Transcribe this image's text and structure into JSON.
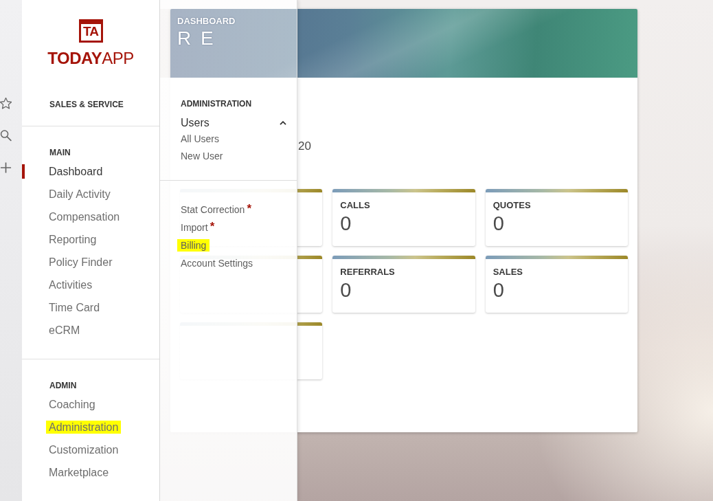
{
  "sidebar": {
    "logo": {
      "badge": "TA",
      "name": "**TODAY**APP"
    },
    "context": "SALES & SERVICE",
    "sections": [
      {
        "title": "MAIN",
        "items": [
          {
            "label": "Dashboard",
            "selected": true,
            "highlighted": false
          },
          {
            "label": "Daily Activity",
            "selected": false,
            "highlighted": false
          },
          {
            "label": "Compensation",
            "selected": false,
            "highlighted": false
          },
          {
            "label": "Reporting",
            "selected": false,
            "highlighted": false
          },
          {
            "label": "Policy Finder",
            "selected": false,
            "highlighted": false
          },
          {
            "label": "Activities",
            "selected": false,
            "highlighted": false
          },
          {
            "label": "Time Card",
            "selected": false,
            "highlighted": false
          },
          {
            "label": "eCRM",
            "selected": false,
            "highlighted": false
          }
        ]
      },
      {
        "title": "ADMIN",
        "items": [
          {
            "label": "Coaching",
            "selected": false,
            "highlighted": false
          },
          {
            "label": "Administration",
            "selected": false,
            "highlighted": true
          },
          {
            "label": "Customization",
            "selected": false,
            "highlighted": false
          },
          {
            "label": "Marketplace",
            "selected": false,
            "highlighted": false
          }
        ]
      }
    ]
  },
  "flyout": {
    "title": "ADMINISTRATION",
    "groups": [
      {
        "label": "Users",
        "expanded": true,
        "children": [
          {
            "label": "All Users",
            "highlighted": false
          },
          {
            "label": "New User",
            "highlighted": false
          }
        ]
      }
    ],
    "items": [
      {
        "label": "Stat Correction",
        "marker": "*",
        "highlighted": false
      },
      {
        "label": "Import",
        "marker": "*",
        "highlighted": false
      },
      {
        "label": "Billing",
        "highlighted": true
      },
      {
        "label": "Account Settings",
        "highlighted": false
      }
    ]
  },
  "dashboard": {
    "eyebrow": "DASHBOARD",
    "title": "R E",
    "date_fragment": "20",
    "cards": [
      {
        "kind": "covered"
      },
      {
        "kind": "stat",
        "label": "CALLS",
        "value": "0"
      },
      {
        "kind": "stat",
        "label": "QUOTES",
        "value": "0"
      },
      {
        "kind": "covered"
      },
      {
        "kind": "stat",
        "label": "REFERRALS",
        "value": "0"
      },
      {
        "kind": "stat",
        "label": "SALES",
        "value": "0"
      },
      {
        "kind": "covered"
      }
    ]
  }
}
